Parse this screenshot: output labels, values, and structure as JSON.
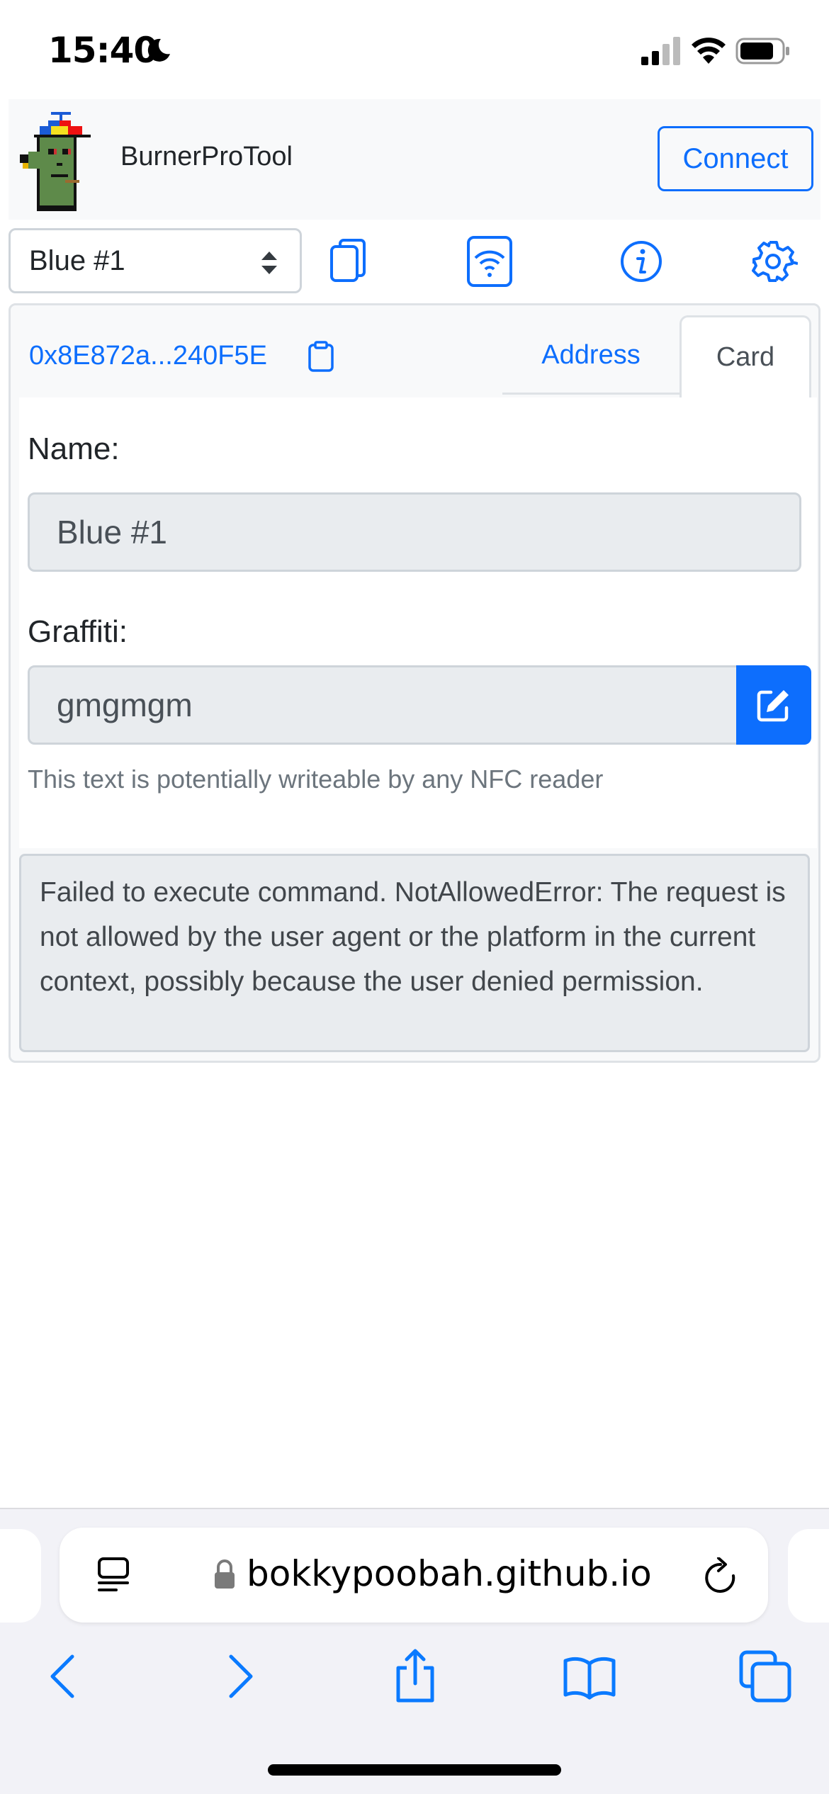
{
  "status_bar": {
    "time": "15:40"
  },
  "navbar": {
    "brand": "BurnerProTool",
    "connect_label": "Connect"
  },
  "toolbar": {
    "selected_card": "Blue #1",
    "icons": [
      "copy-cards-icon",
      "nfc-scan-icon",
      "info-icon",
      "gear-icon"
    ]
  },
  "card": {
    "address_short": "0x8E872a...240F5E",
    "tabs": [
      {
        "label": "Address",
        "active": false
      },
      {
        "label": "Card",
        "active": true
      }
    ],
    "name_label": "Name:",
    "name_value": "Blue #1",
    "graffiti_label": "Graffiti:",
    "graffiti_value": "gmgmgm",
    "graffiti_help": "This text is potentially writeable by any NFC reader"
  },
  "alert": {
    "message": "Failed to execute command. NotAllowedError: The request is not allowed by the user agent or the platform in the current context, possibly because the user denied permission."
  },
  "browser": {
    "url": "bokkypoobah.github.io"
  },
  "colors": {
    "primary": "#0d6efd",
    "navbar_bg": "#f8f9fa",
    "input_bg": "#e9ecef",
    "muted_text": "#6c757d"
  }
}
